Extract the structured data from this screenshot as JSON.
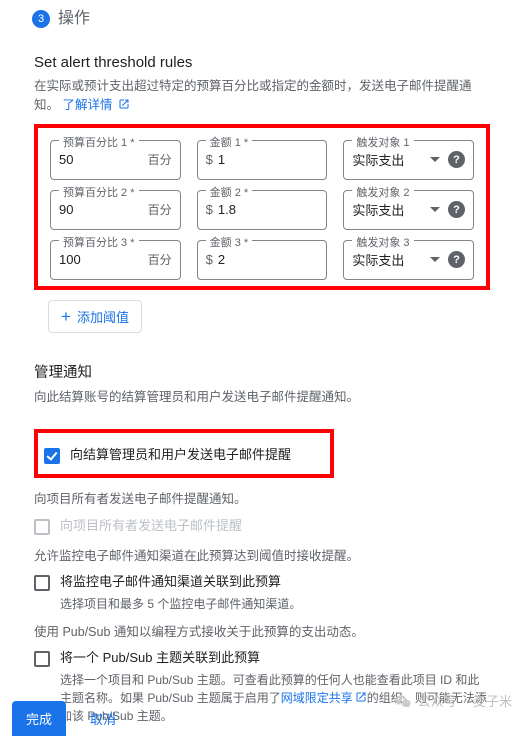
{
  "header": {
    "step_number": "3",
    "step_label": "操作"
  },
  "threshold_section": {
    "title": "Set alert threshold rules",
    "desc_pre": "在实际或预计支出超过特定的预算百分比或指定的金额时，发送电子邮件提醒通知。",
    "learn_more": "了解详情",
    "rows": [
      {
        "pct_label": "预算百分比 1 *",
        "pct_value": "50",
        "pct_suffix": "百分",
        "amt_label": "金额 1 *",
        "amt_prefix": "$",
        "amt_value": "1",
        "trg_label": "触发对象 1",
        "trg_value": "实际支出"
      },
      {
        "pct_label": "预算百分比 2 *",
        "pct_value": "90",
        "pct_suffix": "百分",
        "amt_label": "金额 2 *",
        "amt_prefix": "$",
        "amt_value": "1.8",
        "trg_label": "触发对象 2",
        "trg_value": "实际支出"
      },
      {
        "pct_label": "预算百分比 3 *",
        "pct_value": "100",
        "pct_suffix": "百分",
        "amt_label": "金额 3 *",
        "amt_prefix": "$",
        "amt_value": "2",
        "trg_label": "触发对象 3",
        "trg_value": "实际支出"
      }
    ],
    "add_btn": "添加阈值"
  },
  "mgmt": {
    "title": "管理通知",
    "desc1": "向此结算账号的结算管理员和用户发送电子邮件提醒通知。",
    "cbx_admin": "向结算管理员和用户发送电子邮件提醒",
    "desc2": "向项目所有者发送电子邮件提醒通知。",
    "cbx_owner": "向项目所有者发送电子邮件提醒",
    "desc3": "允许监控电子邮件通知渠道在此预算达到阈值时接收提醒。",
    "cbx_monitor": "将监控电子邮件通知渠道关联到此预算",
    "cbx_monitor_sub": "选择项目和最多 5 个监控电子邮件通知渠道。",
    "desc4": "使用 Pub/Sub 通知以编程方式接收关于此预算的支出动态。",
    "cbx_pubsub": "将一个 Pub/Sub 主题关联到此预算",
    "cbx_pubsub_sub_pre": "选择一个项目和 Pub/Sub 主题。可查看此预算的任何人也能查看此项目 ID 和此主题名称。如果 Pub/Sub 主题属于启用了",
    "cbx_pubsub_link": "网域限定共享",
    "cbx_pubsub_sub_post": "的组织，则可能无法添加该 Pub/Sub 主题。"
  },
  "footer": {
    "done": "完成",
    "cancel": "取消"
  },
  "watermark": {
    "prefix": "公众号",
    "name": "麦子米"
  }
}
